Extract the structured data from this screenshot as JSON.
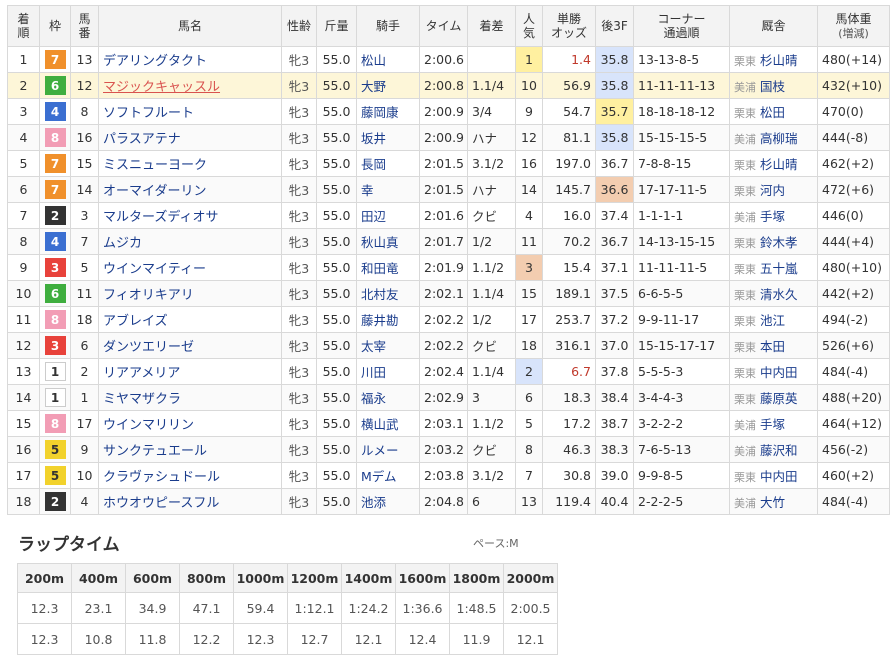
{
  "headers": [
    "着順",
    "枠",
    "馬番",
    "馬名",
    "性齢",
    "斤量",
    "騎手",
    "タイム",
    "着差",
    "人気",
    "単勝オッズ",
    "後3F",
    "コーナー通過順",
    "厩舎",
    "馬体重(増減)"
  ],
  "header_lines": {
    "chakujun": [
      "着",
      "順"
    ],
    "umaban": [
      "馬",
      "番"
    ],
    "ninki": [
      "人",
      "気"
    ],
    "odds": [
      "単勝",
      "オッズ"
    ],
    "corner": [
      "コーナー",
      "通過順"
    ],
    "weight": [
      "馬体重",
      "(増減)"
    ]
  },
  "waku_colors": {
    "1": {
      "bg": "#ffffff",
      "fg": "#333333",
      "border": "#cccccc"
    },
    "2": {
      "bg": "#333333",
      "fg": "#ffffff",
      "border": "#333333"
    },
    "3": {
      "bg": "#e8423b",
      "fg": "#ffffff",
      "border": "#e8423b"
    },
    "4": {
      "bg": "#3b6fd1",
      "fg": "#ffffff",
      "border": "#3b6fd1"
    },
    "5": {
      "bg": "#f2d22c",
      "fg": "#333333",
      "border": "#f2d22c"
    },
    "6": {
      "bg": "#3fae3f",
      "fg": "#ffffff",
      "border": "#3fae3f"
    },
    "7": {
      "bg": "#f0902b",
      "fg": "#ffffff",
      "border": "#f0902b"
    },
    "8": {
      "bg": "#f29db5",
      "fg": "#ffffff",
      "border": "#f29db5"
    }
  },
  "rows": [
    {
      "pos": "1",
      "waku": "7",
      "num": "13",
      "name": "デアリングタクト",
      "sex": "牝3",
      "kin": "55.0",
      "jockey": "松山",
      "time": "2:00.6",
      "margin": "",
      "pop": "1",
      "odds": "1.4",
      "last3f": "35.8",
      "corner": "13-13-8-5",
      "aff": "栗東",
      "trainer": "杉山晴",
      "weight": "480(+14)",
      "pop_class": "fav1",
      "odds_red": true,
      "l3_class": "pace-mid"
    },
    {
      "pos": "2",
      "waku": "6",
      "num": "12",
      "name": "マジックキャッスル",
      "sex": "牝3",
      "kin": "55.0",
      "jockey": "大野",
      "time": "2:00.8",
      "margin": "1.1/4",
      "pop": "10",
      "odds": "56.9",
      "last3f": "35.8",
      "corner": "11-11-11-13",
      "aff": "美浦",
      "trainer": "国枝",
      "weight": "432(+10)",
      "hl": true,
      "link": true,
      "l3_class": "pace-mid"
    },
    {
      "pos": "3",
      "waku": "4",
      "num": "8",
      "name": "ソフトフルート",
      "sex": "牝3",
      "kin": "55.0",
      "jockey": "藤岡康",
      "time": "2:00.9",
      "margin": "3/4",
      "pop": "9",
      "odds": "54.7",
      "last3f": "35.7",
      "corner": "18-18-18-12",
      "aff": "栗東",
      "trainer": "松田",
      "weight": "470(0)",
      "l3_class": "pace-top"
    },
    {
      "pos": "4",
      "waku": "8",
      "num": "16",
      "name": "パラスアテナ",
      "sex": "牝3",
      "kin": "55.0",
      "jockey": "坂井",
      "time": "2:00.9",
      "margin": "ハナ",
      "pop": "12",
      "odds": "81.1",
      "last3f": "35.8",
      "corner": "15-15-15-5",
      "aff": "美浦",
      "trainer": "高柳瑞",
      "weight": "444(-8)",
      "l3_class": "pace-mid"
    },
    {
      "pos": "5",
      "waku": "7",
      "num": "15",
      "name": "ミスニューヨーク",
      "sex": "牝3",
      "kin": "55.0",
      "jockey": "長岡",
      "time": "2:01.5",
      "margin": "3.1/2",
      "pop": "16",
      "odds": "197.0",
      "last3f": "36.7",
      "corner": "7-8-8-15",
      "aff": "栗東",
      "trainer": "杉山晴",
      "weight": "462(+2)"
    },
    {
      "pos": "6",
      "waku": "7",
      "num": "14",
      "name": "オーマイダーリン",
      "sex": "牝3",
      "kin": "55.0",
      "jockey": "幸",
      "time": "2:01.5",
      "margin": "ハナ",
      "pop": "14",
      "odds": "145.7",
      "last3f": "36.6",
      "corner": "17-17-11-5",
      "aff": "栗東",
      "trainer": "河内",
      "weight": "472(+6)",
      "l3_class": "pace-3"
    },
    {
      "pos": "7",
      "waku": "2",
      "num": "3",
      "name": "マルターズディオサ",
      "sex": "牝3",
      "kin": "55.0",
      "jockey": "田辺",
      "time": "2:01.6",
      "margin": "クビ",
      "pop": "4",
      "odds": "16.0",
      "last3f": "37.4",
      "corner": "1-1-1-1",
      "aff": "美浦",
      "trainer": "手塚",
      "weight": "446(0)"
    },
    {
      "pos": "8",
      "waku": "4",
      "num": "7",
      "name": "ムジカ",
      "sex": "牝3",
      "kin": "55.0",
      "jockey": "秋山真",
      "time": "2:01.7",
      "margin": "1/2",
      "pop": "11",
      "odds": "70.2",
      "last3f": "36.7",
      "corner": "14-13-15-15",
      "aff": "栗東",
      "trainer": "鈴木孝",
      "weight": "444(+4)"
    },
    {
      "pos": "9",
      "waku": "3",
      "num": "5",
      "name": "ウインマイティー",
      "sex": "牝3",
      "kin": "55.0",
      "jockey": "和田竜",
      "time": "2:01.9",
      "margin": "1.1/2",
      "pop": "3",
      "odds": "15.4",
      "last3f": "37.1",
      "corner": "11-11-11-5",
      "aff": "栗東",
      "trainer": "五十嵐",
      "weight": "480(+10)",
      "pop_class": "fav3"
    },
    {
      "pos": "10",
      "waku": "6",
      "num": "11",
      "name": "フィオリキアリ",
      "sex": "牝3",
      "kin": "55.0",
      "jockey": "北村友",
      "time": "2:02.1",
      "margin": "1.1/4",
      "pop": "15",
      "odds": "189.1",
      "last3f": "37.5",
      "corner": "6-6-5-5",
      "aff": "栗東",
      "trainer": "清水久",
      "weight": "442(+2)"
    },
    {
      "pos": "11",
      "waku": "8",
      "num": "18",
      "name": "アブレイズ",
      "sex": "牝3",
      "kin": "55.0",
      "jockey": "藤井勘",
      "time": "2:02.2",
      "margin": "1/2",
      "pop": "17",
      "odds": "253.7",
      "last3f": "37.2",
      "corner": "9-9-11-17",
      "aff": "栗東",
      "trainer": "池江",
      "weight": "494(-2)"
    },
    {
      "pos": "12",
      "waku": "3",
      "num": "6",
      "name": "ダンツエリーゼ",
      "sex": "牝3",
      "kin": "55.0",
      "jockey": "太宰",
      "time": "2:02.2",
      "margin": "クビ",
      "pop": "18",
      "odds": "316.1",
      "last3f": "37.0",
      "corner": "15-15-17-17",
      "aff": "栗東",
      "trainer": "本田",
      "weight": "526(+6)"
    },
    {
      "pos": "13",
      "waku": "1",
      "num": "2",
      "name": "リアアメリア",
      "sex": "牝3",
      "kin": "55.0",
      "jockey": "川田",
      "time": "2:02.4",
      "margin": "1.1/4",
      "pop": "2",
      "odds": "6.7",
      "last3f": "37.8",
      "corner": "5-5-5-3",
      "aff": "栗東",
      "trainer": "中内田",
      "weight": "484(-4)",
      "pop_class": "fav2",
      "odds_red": true
    },
    {
      "pos": "14",
      "waku": "1",
      "num": "1",
      "name": "ミヤマザクラ",
      "sex": "牝3",
      "kin": "55.0",
      "jockey": "福永",
      "time": "2:02.9",
      "margin": "3",
      "pop": "6",
      "odds": "18.3",
      "last3f": "38.4",
      "corner": "3-4-4-3",
      "aff": "栗東",
      "trainer": "藤原英",
      "weight": "488(+20)"
    },
    {
      "pos": "15",
      "waku": "8",
      "num": "17",
      "name": "ウインマリリン",
      "sex": "牝3",
      "kin": "55.0",
      "jockey": "横山武",
      "time": "2:03.1",
      "margin": "1.1/2",
      "pop": "5",
      "odds": "17.2",
      "last3f": "38.7",
      "corner": "3-2-2-2",
      "aff": "美浦",
      "trainer": "手塚",
      "weight": "464(+12)"
    },
    {
      "pos": "16",
      "waku": "5",
      "num": "9",
      "name": "サンクテュエール",
      "sex": "牝3",
      "kin": "55.0",
      "jockey": "ルメー",
      "time": "2:03.2",
      "margin": "クビ",
      "pop": "8",
      "odds": "46.3",
      "last3f": "38.3",
      "corner": "7-6-5-13",
      "aff": "美浦",
      "trainer": "藤沢和",
      "weight": "456(-2)"
    },
    {
      "pos": "17",
      "waku": "5",
      "num": "10",
      "name": "クラヴァシュドール",
      "sex": "牝3",
      "kin": "55.0",
      "jockey": "Mデム",
      "time": "2:03.8",
      "margin": "3.1/2",
      "pop": "7",
      "odds": "30.8",
      "last3f": "39.0",
      "corner": "9-9-8-5",
      "aff": "栗東",
      "trainer": "中内田",
      "weight": "460(+2)"
    },
    {
      "pos": "18",
      "waku": "2",
      "num": "4",
      "name": "ホウオウピースフル",
      "sex": "牝3",
      "kin": "55.0",
      "jockey": "池添",
      "time": "2:04.8",
      "margin": "6",
      "pop": "13",
      "odds": "119.4",
      "last3f": "40.4",
      "corner": "2-2-2-5",
      "aff": "美浦",
      "trainer": "大竹",
      "weight": "484(-4)"
    }
  ],
  "lap": {
    "title": "ラップタイム",
    "pace": "ペース:M",
    "distances": [
      "200m",
      "400m",
      "600m",
      "800m",
      "1000m",
      "1200m",
      "1400m",
      "1600m",
      "1800m",
      "2000m"
    ],
    "cumulative": [
      "12.3",
      "23.1",
      "34.9",
      "47.1",
      "59.4",
      "1:12.1",
      "1:24.2",
      "1:36.6",
      "1:48.5",
      "2:00.5"
    ],
    "splits": [
      "12.3",
      "10.8",
      "11.8",
      "12.2",
      "12.3",
      "12.7",
      "12.1",
      "12.4",
      "11.9",
      "12.1"
    ]
  }
}
